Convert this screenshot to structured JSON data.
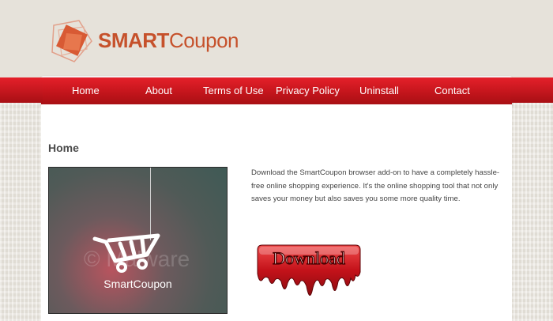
{
  "brand": {
    "name_bold": "SMART",
    "name_light": "Coupon",
    "accent_color": "#c6512b"
  },
  "nav": {
    "items": [
      {
        "label": "Home"
      },
      {
        "label": "About"
      },
      {
        "label": "Terms of Use"
      },
      {
        "label": "Privacy Policy"
      },
      {
        "label": "Uninstall"
      },
      {
        "label": "Contact"
      }
    ],
    "bar_color": "#d2181f"
  },
  "main": {
    "title": "Home",
    "product_label": "SmartCoupon",
    "watermark": "© Malware",
    "description": "Download the SmartCoupon browser add-on to have a completely hassle-free online shopping experience. It's the online shopping tool that not only saves your money but also saves you some more quality time.",
    "download_label": "Download"
  },
  "icons": {
    "cart": "shopping-cart-icon",
    "logo": "smartcoupon-logo-icon"
  }
}
